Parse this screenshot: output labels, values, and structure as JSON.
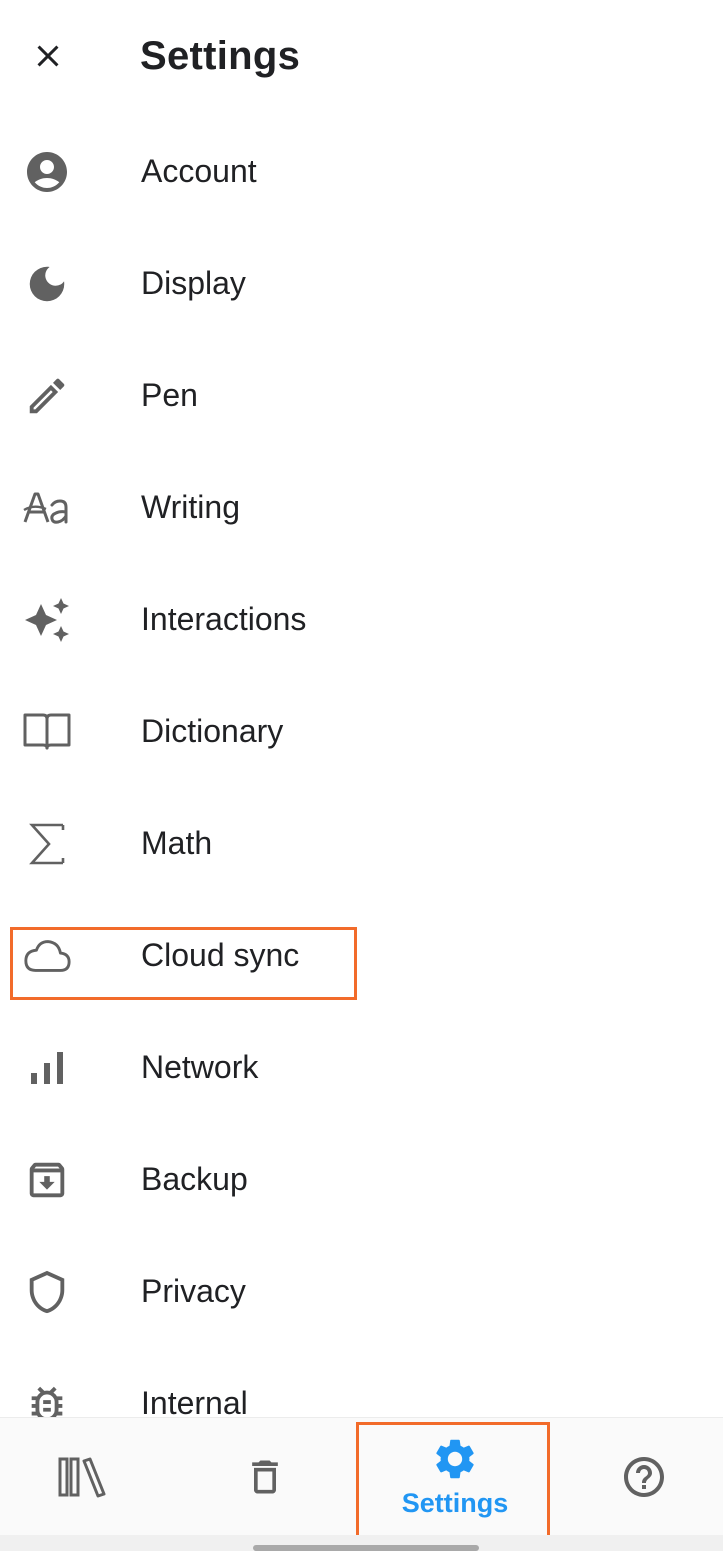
{
  "header": {
    "title": "Settings",
    "close_icon": "close-icon"
  },
  "menu": {
    "items": [
      {
        "label": "Account",
        "icon": "account-circle-icon"
      },
      {
        "label": "Display",
        "icon": "moon-icon"
      },
      {
        "label": "Pen",
        "icon": "pencil-icon"
      },
      {
        "label": "Writing",
        "icon": "text-format-icon"
      },
      {
        "label": "Interactions",
        "icon": "sparkles-icon"
      },
      {
        "label": "Dictionary",
        "icon": "open-book-icon"
      },
      {
        "label": "Math",
        "icon": "sigma-icon"
      },
      {
        "label": "Cloud sync",
        "icon": "cloud-icon",
        "highlighted": true
      },
      {
        "label": "Network",
        "icon": "signal-bars-icon"
      },
      {
        "label": "Backup",
        "icon": "archive-icon"
      },
      {
        "label": "Privacy",
        "icon": "shield-icon"
      },
      {
        "label": "Internal",
        "icon": "bug-icon"
      }
    ]
  },
  "bottom_nav": {
    "items": [
      {
        "name": "library",
        "icon": "library-icon"
      },
      {
        "name": "trash",
        "icon": "trash-icon"
      },
      {
        "name": "settings",
        "label": "Settings",
        "icon": "gear-icon",
        "active": true
      },
      {
        "name": "help",
        "icon": "help-icon"
      }
    ]
  },
  "colors": {
    "accent": "#2196f3",
    "highlight": "#f26b2a",
    "icon": "#616161",
    "text": "#202124"
  }
}
